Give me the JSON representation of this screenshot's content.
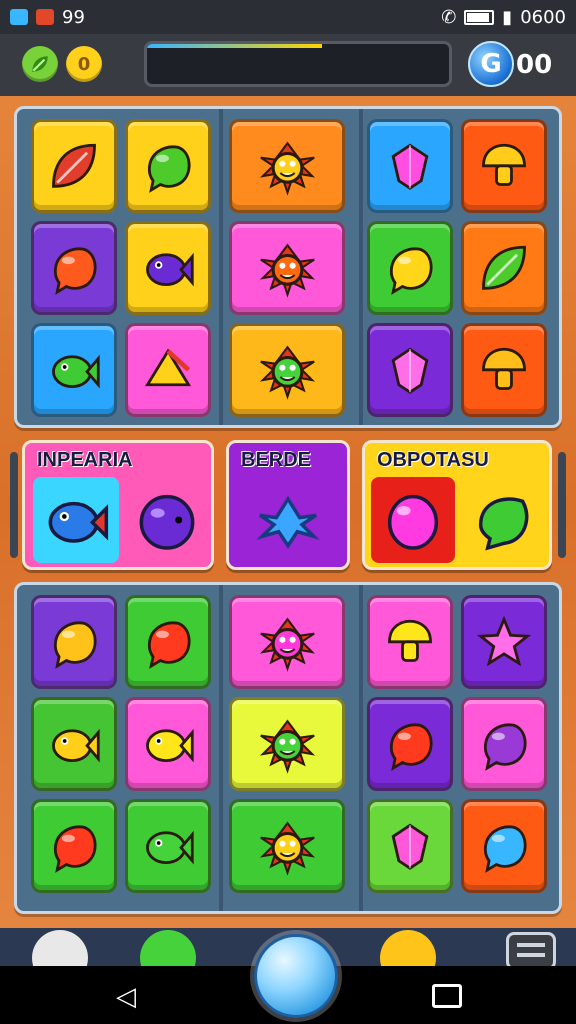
{
  "statusbar": {
    "left_text": "99",
    "right_text": "0600"
  },
  "hud": {
    "coin_left_label": "",
    "coin_right_label": "0",
    "progress_fraction": 0.58,
    "orb_label": "G",
    "score": "00"
  },
  "colors": {
    "board": "#e07a34",
    "panel": "#4c6f8c",
    "accent": "#38b6ff"
  },
  "top_panel": {
    "left_tiles": [
      {
        "bg": "#ffd11a",
        "icon": "leaf-icon",
        "c": "#e23c2a"
      },
      {
        "bg": "#ffd11a",
        "icon": "blob-icon",
        "c": "#4ccb2a"
      },
      {
        "bg": "#7a3ad6",
        "icon": "blob-icon",
        "c": "#ff5a1e"
      },
      {
        "bg": "#ffd11a",
        "icon": "fish-icon",
        "c": "#6a2ad4"
      },
      {
        "bg": "#2aa6ff",
        "icon": "fish-icon",
        "c": "#3ecb34"
      },
      {
        "bg": "#ff58d8",
        "icon": "shell-icon",
        "c": "#ffd11a"
      }
    ],
    "mid_tiles": [
      {
        "bg": "#ff8a1e",
        "icon": "monster-icon",
        "c": "#ffcf1a"
      },
      {
        "bg": "#ff58d8",
        "icon": "monster-icon",
        "c": "#ff6a10"
      },
      {
        "bg": "#ffb81a",
        "icon": "monster-icon",
        "c": "#46d23a"
      }
    ],
    "right_tiles": [
      {
        "bg": "#2aa6ff",
        "icon": "crystal-icon",
        "c": "#ff4ee0"
      },
      {
        "bg": "#ff5a14",
        "icon": "mushroom-icon",
        "c": "#ffcc1a"
      },
      {
        "bg": "#3ecb34",
        "icon": "blob-icon",
        "c": "#ffd61a"
      },
      {
        "bg": "#ff7a14",
        "icon": "leaf-icon",
        "c": "#4ccb2a"
      },
      {
        "bg": "#7a2ad6",
        "icon": "crystal-icon",
        "c": "#ff6ee8"
      },
      {
        "bg": "#ff5a14",
        "icon": "mushroom-icon",
        "c": "#ffbe1a"
      }
    ]
  },
  "cards": [
    {
      "title": "INPEARIA"
    },
    {
      "title": "BERDE"
    },
    {
      "title": "OBPOTASU"
    }
  ],
  "bottom_panel": {
    "left_tiles": [
      {
        "bg": "#7a3ad6",
        "icon": "blob-icon",
        "c": "#ffc21a"
      },
      {
        "bg": "#3ecb34",
        "icon": "blob-icon",
        "c": "#ff3a1e"
      },
      {
        "bg": "#46c534",
        "icon": "fish-icon",
        "c": "#ffcf1a"
      },
      {
        "bg": "#ff58d8",
        "icon": "fish-icon",
        "c": "#ffe61a"
      },
      {
        "bg": "#3ecb34",
        "icon": "blob-icon",
        "c": "#ff3a1e"
      },
      {
        "bg": "#3ecb34",
        "icon": "fish-icon",
        "c": "#46d23a"
      }
    ],
    "mid_tiles": [
      {
        "bg": "#ff58d8",
        "icon": "monster-icon",
        "c": "#ff3ad8"
      },
      {
        "bg": "#e8f83a",
        "icon": "monster-icon",
        "c": "#46d23a"
      },
      {
        "bg": "#3ecb34",
        "icon": "monster-icon",
        "c": "#ffcf1a"
      }
    ],
    "right_tiles": [
      {
        "bg": "#ff58d8",
        "icon": "mushroom-icon",
        "c": "#ffe61a"
      },
      {
        "bg": "#7a2ad6",
        "icon": "star-icon",
        "c": "#ff6ee8"
      },
      {
        "bg": "#7a2ad6",
        "icon": "blob-icon",
        "c": "#ff3a1e"
      },
      {
        "bg": "#ff58d8",
        "icon": "blob-icon",
        "c": "#9a3ad6"
      },
      {
        "bg": "#6ad83a",
        "icon": "crystal-icon",
        "c": "#ff58d8"
      },
      {
        "bg": "#ff5a14",
        "icon": "blob-icon",
        "c": "#38b6ff"
      }
    ]
  }
}
